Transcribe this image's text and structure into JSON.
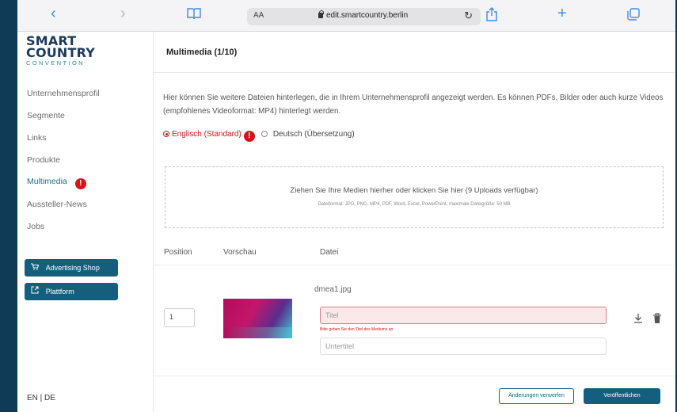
{
  "browser": {
    "back": "‹",
    "forward": "›",
    "text_size": "AA",
    "url": "edit.smartcountry.berlin",
    "reload": "↻",
    "new_tab": "+"
  },
  "logo": {
    "line1": "SMART",
    "line2": "COUNTRY",
    "line3": "CONVENTION"
  },
  "sidebar": {
    "items": [
      {
        "label": "Unternehmensprofil",
        "active": false
      },
      {
        "label": "Segmente",
        "active": false
      },
      {
        "label": "Links",
        "active": false
      },
      {
        "label": "Produkte",
        "active": false
      },
      {
        "label": "Multimedia",
        "active": true,
        "badge": "!"
      },
      {
        "label": "Aussteller-News",
        "active": false
      },
      {
        "label": "Jobs",
        "active": false
      }
    ],
    "advertising_shop": "Advertising Shop",
    "platform": "Plattform",
    "lang": "EN | DE"
  },
  "main": {
    "title": "Multimedia (1/10)",
    "description": "Hier können Sie weitere Dateien hinterlegen, die in Ihrem Unternehmensprofil angezeigt werden. Es können PDFs, Bilder oder auch kurze Videos (empfohlenes Videoformat: MP4) hinterlegt werden.",
    "lang_en": "Englisch (Standard)",
    "lang_en_badge": "!",
    "lang_de": "Deutsch (Übersetzung)",
    "dropzone_main": "Ziehen Sie Ihre Medien hierher oder klicken Sie hier (9 Uploads verfügbar)",
    "dropzone_sub": "Dateiformat: JPG, PNG, MP4, PDF, Word, Excel, PowerPoint, maximale Dateigröße: 50 MB",
    "col_position": "Position",
    "col_preview": "Vorschau",
    "col_file": "Datei",
    "row": {
      "filename": "dmea1.jpg",
      "position": "1",
      "title_placeholder": "Titel",
      "title_error": "Bitte geben Sie den Titel des Mediums an",
      "subtitle_placeholder": "Untertitel"
    },
    "discard_label": "Änderungen verwerfen",
    "publish_label": "Veröffentlichen"
  }
}
